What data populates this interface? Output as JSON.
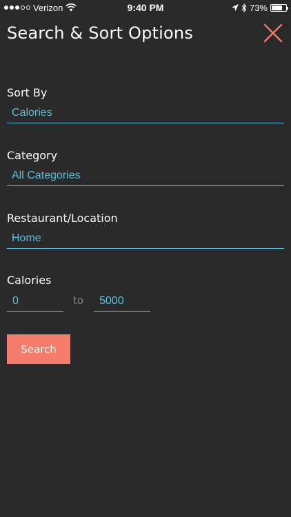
{
  "status_bar": {
    "carrier": "Verizon",
    "time": "9:40 PM",
    "battery": "73%",
    "battery_level": 0.73,
    "signal_bars": 3,
    "icons": [
      "wifi-icon",
      "location-arrow-icon",
      "bluetooth-icon",
      "battery-icon"
    ]
  },
  "header": {
    "title": "Search & Sort Options",
    "close_icon": "close-icon",
    "accent_color": "#f47c6c"
  },
  "form": {
    "sort_by": {
      "label": "Sort By",
      "value": "Calories"
    },
    "category": {
      "label": "Category",
      "value": "All Categories"
    },
    "restaurant": {
      "label": "Restaurant/Location",
      "value": "Home"
    },
    "calories": {
      "label": "Calories",
      "min": "0",
      "separator": "to",
      "max": "5000"
    },
    "search_button": "Search",
    "value_color": "#5bc0de"
  }
}
